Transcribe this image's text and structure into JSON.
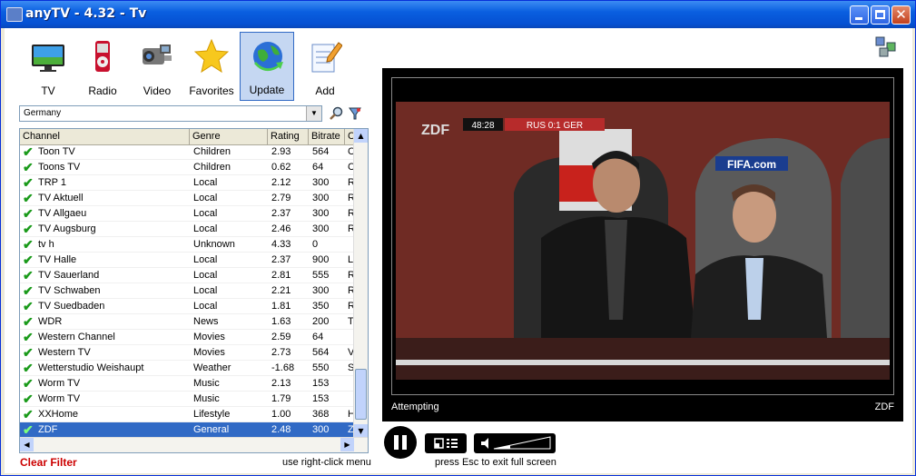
{
  "window": {
    "title": "anyTV - 4.32 - Tv"
  },
  "toolbar": {
    "tv": "TV",
    "radio": "Radio",
    "video": "Video",
    "favorites": "Favorites",
    "update": "Update",
    "add": "Add"
  },
  "country_select": {
    "value": "Germany"
  },
  "table": {
    "headers": [
      "Channel",
      "Genre",
      "Rating",
      "Bitrate",
      "Co"
    ],
    "rows": [
      {
        "channel": "Toon TV",
        "genre": "Children",
        "rating": "2.93",
        "bitrate": "564",
        "co": "C"
      },
      {
        "channel": "Toons TV",
        "genre": "Children",
        "rating": "0.62",
        "bitrate": "64",
        "co": "C"
      },
      {
        "channel": "TRP 1",
        "genre": "Local",
        "rating": "2.12",
        "bitrate": "300",
        "co": "R"
      },
      {
        "channel": "TV Aktuell",
        "genre": "Local",
        "rating": "2.79",
        "bitrate": "300",
        "co": "R"
      },
      {
        "channel": "TV Allgaeu",
        "genre": "Local",
        "rating": "2.37",
        "bitrate": "300",
        "co": "R"
      },
      {
        "channel": "TV Augsburg",
        "genre": "Local",
        "rating": "2.46",
        "bitrate": "300",
        "co": "R"
      },
      {
        "channel": "tv h",
        "genre": "Unknown",
        "rating": "4.33",
        "bitrate": "0",
        "co": ""
      },
      {
        "channel": "TV Halle",
        "genre": "Local",
        "rating": "2.37",
        "bitrate": "900",
        "co": "L"
      },
      {
        "channel": "TV Sauerland",
        "genre": "Local",
        "rating": "2.81",
        "bitrate": "555",
        "co": "R"
      },
      {
        "channel": "TV Schwaben",
        "genre": "Local",
        "rating": "2.21",
        "bitrate": "300",
        "co": "R"
      },
      {
        "channel": "TV Suedbaden",
        "genre": "Local",
        "rating": "1.81",
        "bitrate": "350",
        "co": "R"
      },
      {
        "channel": "WDR",
        "genre": "News",
        "rating": "1.63",
        "bitrate": "200",
        "co": "T"
      },
      {
        "channel": "Western Channel",
        "genre": "Movies",
        "rating": "2.59",
        "bitrate": "64",
        "co": ""
      },
      {
        "channel": "Western TV",
        "genre": "Movies",
        "rating": "2.73",
        "bitrate": "564",
        "co": "V"
      },
      {
        "channel": "Wetterstudio Weishaupt",
        "genre": "Weather",
        "rating": "-1.68",
        "bitrate": "550",
        "co": "S"
      },
      {
        "channel": "Worm TV",
        "genre": "Music",
        "rating": "2.13",
        "bitrate": "153",
        "co": ""
      },
      {
        "channel": "Worm TV",
        "genre": "Music",
        "rating": "1.79",
        "bitrate": "153",
        "co": ""
      },
      {
        "channel": "XXHome",
        "genre": "Lifestyle",
        "rating": "1.00",
        "bitrate": "368",
        "co": "H"
      },
      {
        "channel": "ZDF",
        "genre": "General",
        "rating": "2.48",
        "bitrate": "300",
        "co": "Z",
        "selected": true
      }
    ]
  },
  "footer": {
    "clear_filter": "Clear Filter",
    "right_click_hint": "use right-click menu",
    "esc_hint": "press Esc to exit full screen"
  },
  "player": {
    "status": "Attempting",
    "channel": "ZDF",
    "scoreboard_time": "48:28",
    "scoreboard_score": "RUS 0:1 GER",
    "broadcaster_logo": "ZDF",
    "sponsor_text": "FIFA.com"
  },
  "colors": {
    "accent": "#316ac5",
    "clear_filter": "#cc0000",
    "check": "#1a9a1a"
  }
}
